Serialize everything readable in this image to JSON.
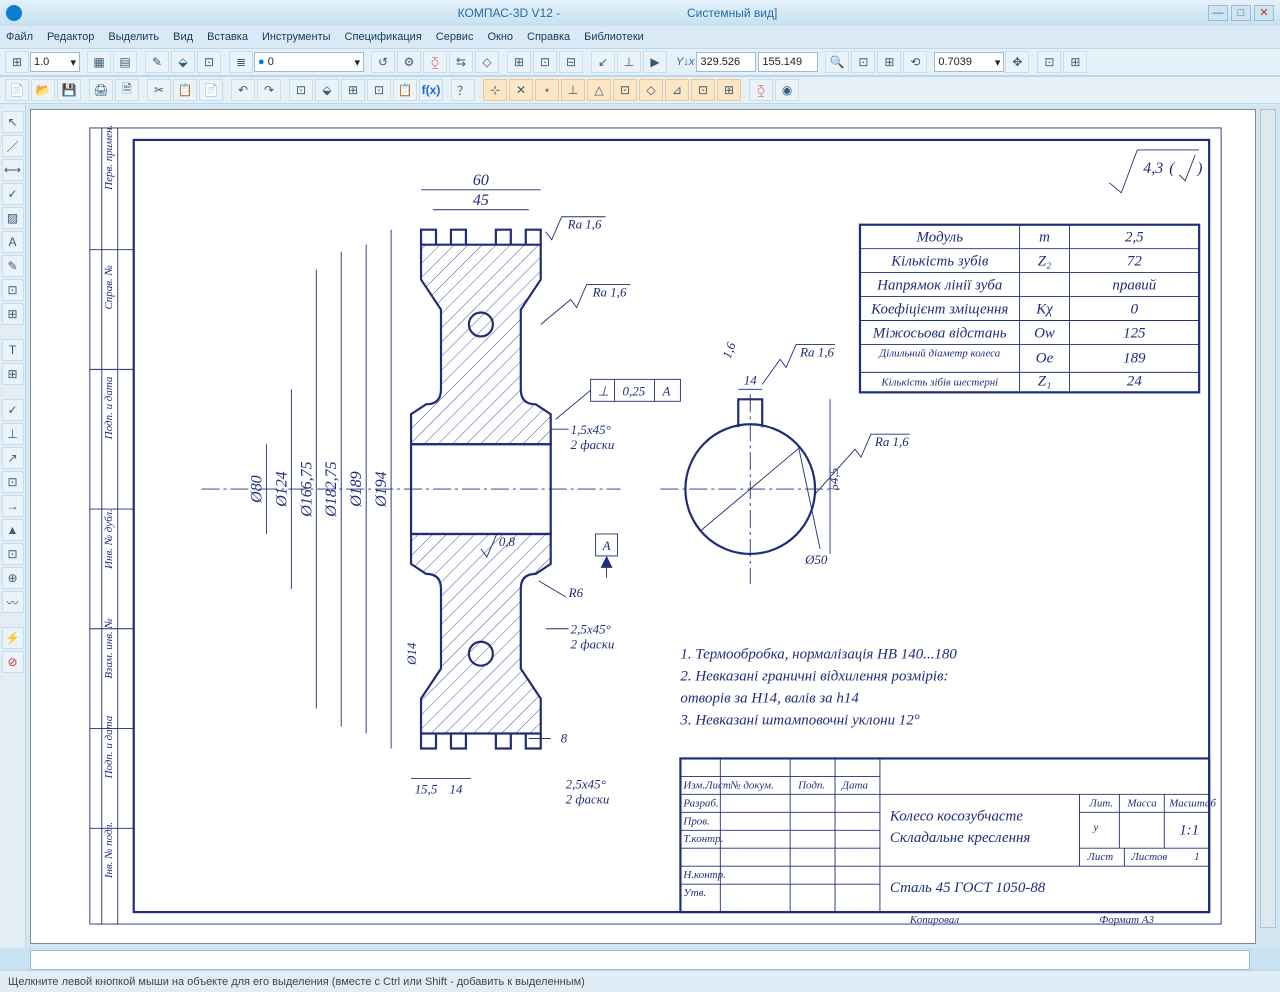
{
  "app": {
    "title": "КОМПАС-3D V12 -",
    "view_suffix": "Системный вид]"
  },
  "menu": [
    "Файл",
    "Редактор",
    "Выделить",
    "Вид",
    "Вставка",
    "Инструменты",
    "Спецификация",
    "Сервис",
    "Окно",
    "Справка",
    "Библиотеки"
  ],
  "toolbar1": {
    "style_val": "1.0",
    "layer_val": "0",
    "coord_x": "329.526",
    "coord_y": "155.149",
    "zoom": "0.7039"
  },
  "status": "Щелкните левой кнопкой мыши на объекте для его выделения (вместе с Ctrl или Shift - добавить к выделенным)",
  "drawing": {
    "roughness_global": "4,3",
    "dims": {
      "d60": "60",
      "d45": "45",
      "d194": "Ø194",
      "d189": "Ø189",
      "d18275": "Ø182,75",
      "d16675": "Ø166,75",
      "d124": "Ø124",
      "d80": "Ø80",
      "d14": "Ø14",
      "ra16": "Ra 1,6",
      "ra08": "0,8",
      "d155": "15,5",
      "d14b": "14",
      "d8": "8",
      "cham25": "2,5x45°",
      "cham15": "1,5x45°",
      "chamtxt": "2 фаски",
      "tol": "0,25",
      "datum": "A",
      "r6": "R6",
      "angle16": "1,6",
      "d545": "54,5",
      "d50h": "Ø50",
      "d14k": "14"
    },
    "params": [
      {
        "name": "Модуль",
        "sym": "m",
        "val": "2,5"
      },
      {
        "name": "Кількість зубів",
        "sym": "Z₂",
        "val": "72"
      },
      {
        "name": "Напрямок лінії зуба",
        "sym": "",
        "val": "правий"
      },
      {
        "name": "Коефіцієнт зміщення",
        "sym": "Kχ",
        "val": "0"
      },
      {
        "name": "Міжосьова відстань",
        "sym": "Ow",
        "val": "125"
      },
      {
        "name": "Ділильний діаметр колеса",
        "sym": "Oe",
        "val": "189"
      },
      {
        "name": "Кількість зібів шестерні",
        "sym": "Z₁",
        "val": "24"
      }
    ],
    "notes": [
      "1. Термообробка, нормалізація НВ 140...180",
      "2. Невказані граничні відхилення розмірів:",
      "отворів за Н14, валів за h14",
      "3. Невказані штамповочні уклони 12°"
    ],
    "titleblock": {
      "name1": "Колесо косозубчасте",
      "name2": "Складальне креслення",
      "material": "Сталь 45 ГОСТ 1050-88",
      "scale": "1:1",
      "lit": "у",
      "sheets": "1",
      "rows": [
        "Изм.Лист",
        "Разраб.",
        "Пров.",
        "Т.контр.",
        "Н.контр.",
        "Утв."
      ],
      "hdrs": [
        "№ докум.",
        "Подп.",
        "Дата",
        "Лит.",
        "Масса",
        "Масштаб",
        "Лист",
        "Листов"
      ],
      "copier": "Копировал",
      "format": "Формат    А3"
    },
    "vlabels": [
      "Інв. № подл.",
      "Подп. и дата",
      "Взам. инв. №",
      "Инв. № дубл.",
      "Подп. и дата",
      "Справ. №",
      "Перв. примен."
    ]
  }
}
